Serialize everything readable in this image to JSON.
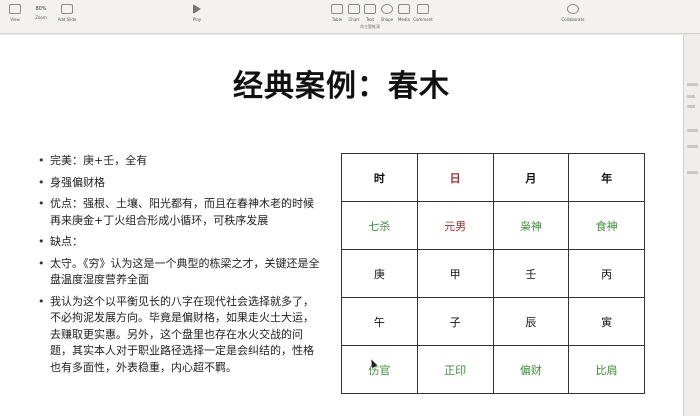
{
  "toolbar": {
    "items": [
      {
        "label": "View"
      },
      {
        "label": "Zoom"
      },
      {
        "label": "Add Slide"
      },
      {
        "label": "Play"
      },
      {
        "label": "Table"
      },
      {
        "label": "Chart"
      },
      {
        "label": "Text"
      },
      {
        "label": "Shape"
      },
      {
        "label": "Media"
      },
      {
        "label": "Comment"
      },
      {
        "label": "Collaborate"
      }
    ],
    "zoom_value": "80%",
    "doc_title": "命主题推演"
  },
  "slide": {
    "title": "经典案例：春木",
    "bullets": [
      "完美：庚+壬，全有",
      "身强偏财格",
      "优点：强根、土壤、阳光都有，而且在春神木老的时候再来庚金+丁火组合形成小循环，可秩序发展",
      "缺点：",
      "太守。《穷》认为这是一个典型的栋梁之才，关键还是全盘温度湿度营养全面",
      "我认为这个以平衡见长的八字在现代社会选择就多了，不必拘泥发展方向。毕竟是偏财格，如果走火土大运，去赚取更实惠。另外，这个盘里也存在水火交战的问题，其实本人对于职业路径选择一定是会纠结的，性格也有多面性，外表稳重，内心超不羁。"
    ],
    "table": {
      "header": [
        "时",
        "日",
        "月",
        "年"
      ],
      "gods": [
        "七杀",
        "元男",
        "枭神",
        "食神"
      ],
      "stems": [
        "庚",
        "甲",
        "壬",
        "丙"
      ],
      "branches": [
        "午",
        "子",
        "辰",
        "寅"
      ],
      "hidden": [
        "伤官",
        "正印",
        "偏财",
        "比肩"
      ]
    }
  },
  "colors": {
    "red": "#b02a2a",
    "green": "#3e8f3a"
  }
}
